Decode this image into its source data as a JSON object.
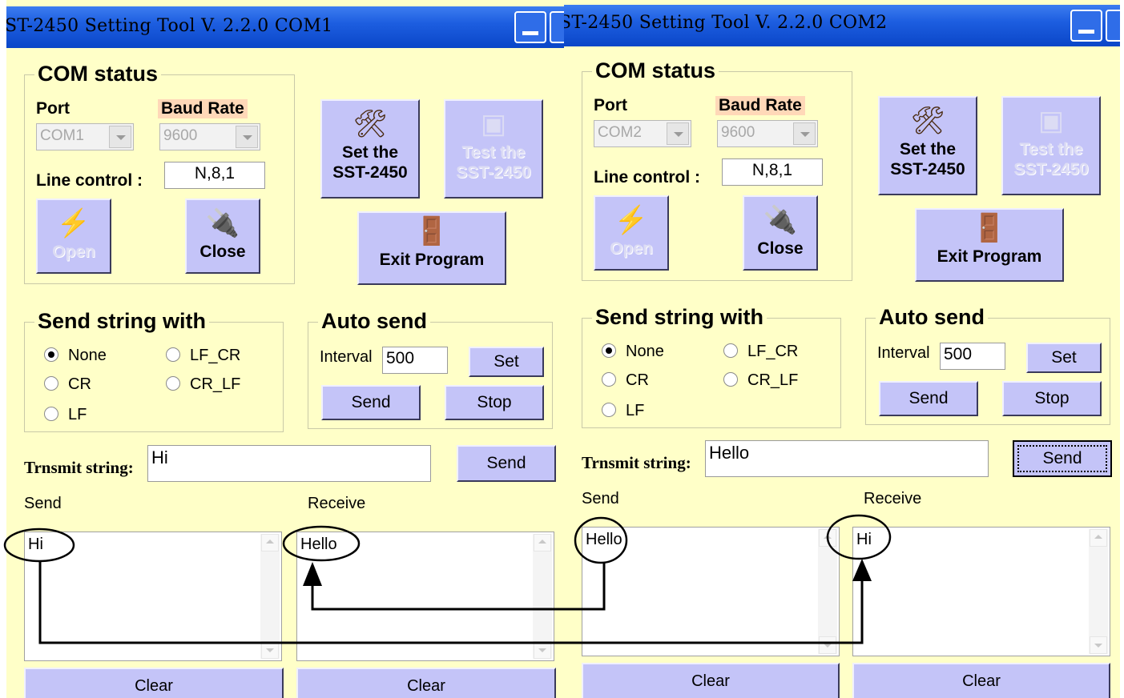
{
  "windows": [
    {
      "title": "ST-2450 Setting Tool  V. 2.2.0  COM1",
      "com_status": {
        "group_title": "COM status",
        "port_label": "Port",
        "port_value": "COM1",
        "baud_label": "Baud Rate",
        "baud_value": "9600",
        "line_control_label": "Line control :",
        "line_control_value": "N,8,1",
        "open_label": "Open",
        "close_label": "Close"
      },
      "set_button": {
        "line1": "Set the",
        "line2": "SST-2450"
      },
      "test_button": {
        "line1": "Test the",
        "line2": "SST-2450"
      },
      "exit_label": "Exit Program",
      "send_string_with": {
        "group_title": "Send string with",
        "options": [
          "None",
          "LF_CR",
          "CR",
          "CR_LF",
          "LF"
        ],
        "selected": "None"
      },
      "auto_send": {
        "group_title": "Auto send",
        "interval_label": "Interval",
        "interval_value": "500",
        "set_label": "Set",
        "send_label": "Send",
        "stop_label": "Stop"
      },
      "transmit": {
        "label": "Trnsmit string:",
        "value": "Hi",
        "send_label": "Send"
      },
      "send_area": {
        "label": "Send",
        "content": "Hi",
        "clear_label": "Clear"
      },
      "receive_area": {
        "label": "Receive",
        "content": "Hello",
        "clear_label": "Clear"
      }
    },
    {
      "title": "ST-2450 Setting Tool  V. 2.2.0  COM2",
      "com_status": {
        "group_title": "COM status",
        "port_label": "Port",
        "port_value": "COM2",
        "baud_label": "Baud Rate",
        "baud_value": "9600",
        "line_control_label": "Line control :",
        "line_control_value": "N,8,1",
        "open_label": "Open",
        "close_label": "Close"
      },
      "set_button": {
        "line1": "Set the",
        "line2": "SST-2450"
      },
      "test_button": {
        "line1": "Test the",
        "line2": "SST-2450"
      },
      "exit_label": "Exit Program",
      "send_string_with": {
        "group_title": "Send string with",
        "options": [
          "None",
          "LF_CR",
          "CR",
          "CR_LF",
          "LF"
        ],
        "selected": "None"
      },
      "auto_send": {
        "group_title": "Auto send",
        "interval_label": "Interval",
        "interval_value": "500",
        "set_label": "Set",
        "send_label": "Send",
        "stop_label": "Stop"
      },
      "transmit": {
        "label": "Trnsmit string:",
        "value": "Hello",
        "send_label": "Send"
      },
      "send_area": {
        "label": "Send",
        "content": "Hello",
        "clear_label": "Clear"
      },
      "receive_area": {
        "label": "Receive",
        "content": "Hi",
        "clear_label": "Clear"
      }
    }
  ],
  "colors": {
    "window_bg": "#ffffc8",
    "button_bg": "#c4c4f8",
    "titlebar": "#1d5ee0",
    "baud_highlight": "#ffd8b8"
  }
}
